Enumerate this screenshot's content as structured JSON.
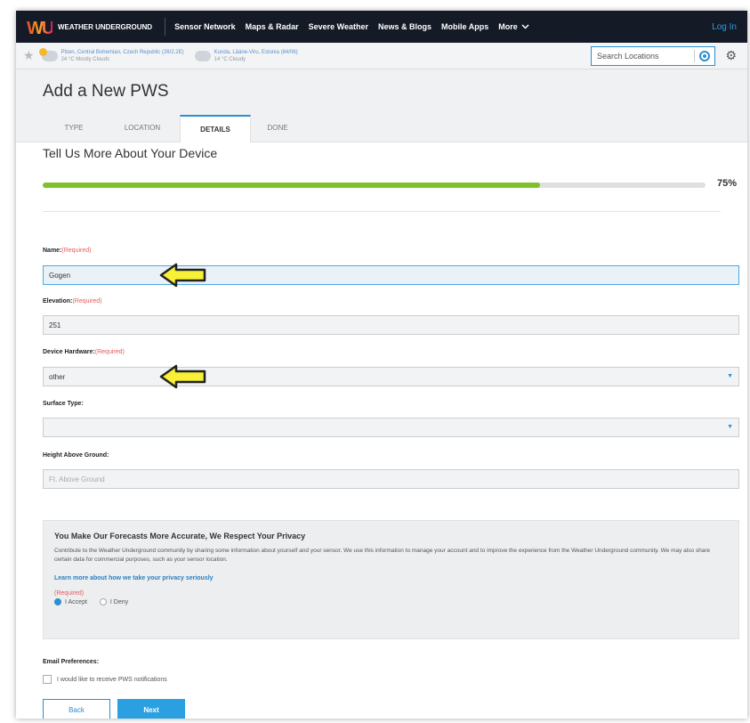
{
  "nav": {
    "logo_text": "WEATHER UNDERGROUND",
    "links": [
      "Sensor Network",
      "Maps & Radar",
      "Severe Weather",
      "News & Blogs",
      "Mobile Apps"
    ],
    "more_label": "More",
    "login_label": "Log In"
  },
  "locbar": {
    "loc1": "Plzen, Central Bohemian, Czech Republic (26/2.2E)",
    "loc1_sub": "24 °C Mostly Clouds",
    "loc2": "Kunda, Lääne-Viru, Estonia (84/06)",
    "loc2_sub": "14 °C Cloudy",
    "search_placeholder": "Search Locations"
  },
  "page": {
    "title": "Add a New PWS",
    "tabs": [
      "TYPE",
      "LOCATION",
      "DETAILS",
      "DONE"
    ],
    "active_tab": "DETAILS"
  },
  "details": {
    "section_title": "Tell Us More About Your Device",
    "progress_value": 0.75,
    "progress_label": "75%",
    "required_label": "(Required)",
    "name_label": "Name:",
    "name_value": "Gogen",
    "elevation_label": "Elevation:",
    "elevation_value": "251",
    "hardware_label": "Device Hardware:",
    "hardware_value": "other",
    "surface_label": "Surface Type:",
    "surface_value": "",
    "height_label": "Height Above Ground:",
    "height_placeholder": "Ft. Above Ground"
  },
  "privacy": {
    "title": "You Make Our Forecasts More Accurate, We Respect Your Privacy",
    "body": "Contribute to the Weather Underground community by sharing some information about yourself and your sensor. We use this information to manage your account and to improve the experience from the Weather Underground community. We may also share certain data for commercial purposes, such as your sensor location.",
    "link": "Learn more about how we take your privacy seriously",
    "required": "(Required)",
    "accept_label": "I Accept",
    "deny_label": "I Deny",
    "accepted": true
  },
  "email": {
    "label": "Email Preferences:",
    "checkbox_label": "I would like to receive PWS notifications"
  },
  "buttons": {
    "back": "Back",
    "next": "Next"
  },
  "colors": {
    "accent": "#2b8fd1",
    "progress": "#7dc22a",
    "required": "#e85a5a",
    "nav_bg": "#151a27",
    "arrow": "#f7f036"
  }
}
